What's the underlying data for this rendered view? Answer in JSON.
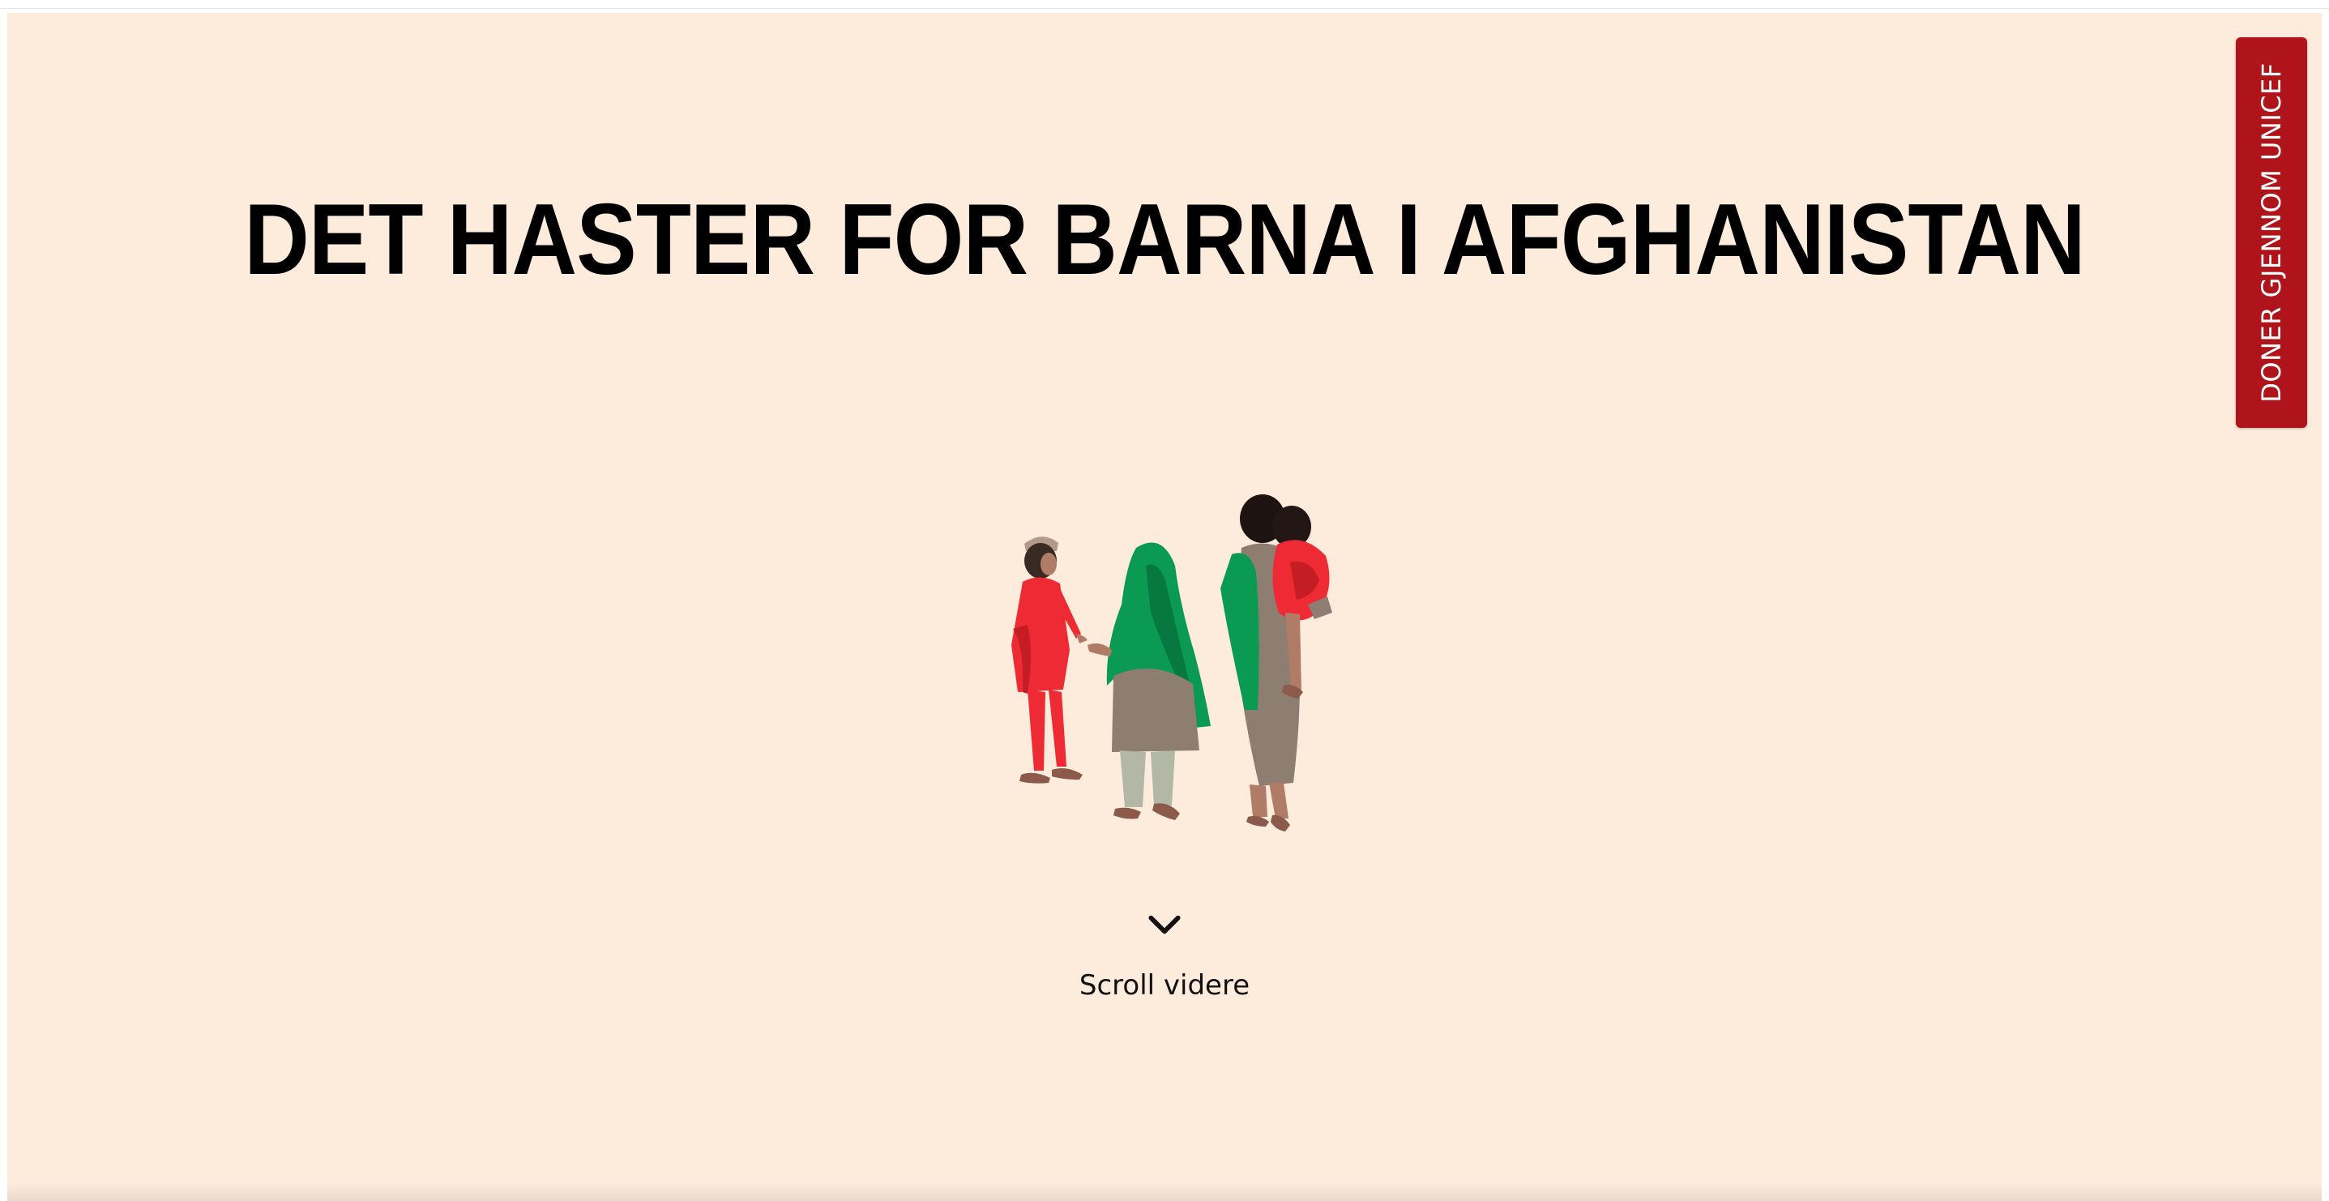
{
  "hero": {
    "title": "DET HASTER FOR BARNA I AFGHANISTAN",
    "background_color": "#fdebdc",
    "illustration": "children-walking-illustration",
    "scroll": {
      "icon": "chevron-down-icon",
      "label": "Scroll videre"
    }
  },
  "donate": {
    "label": "DONER GJENNOM UNICEF",
    "color": "#b0141b"
  }
}
